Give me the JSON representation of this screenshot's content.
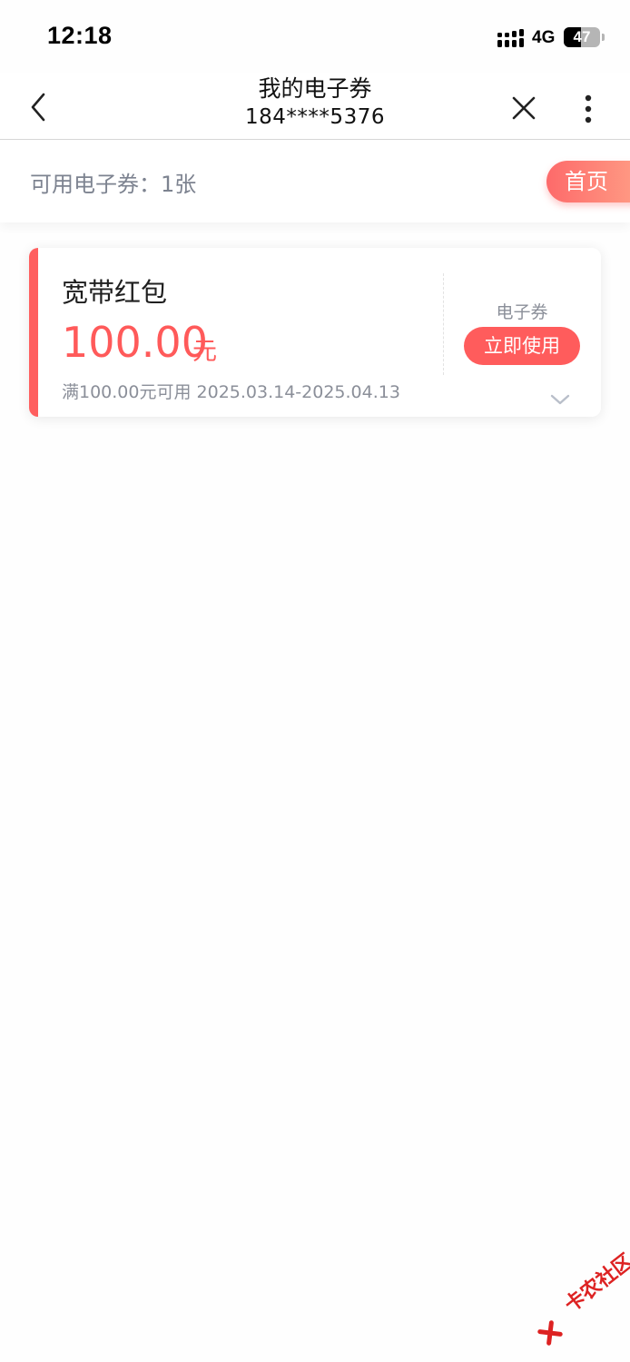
{
  "status_bar": {
    "time": "12:18",
    "network": "4G",
    "battery": "47",
    "battery_level": 0.47
  },
  "nav": {
    "title": "我的电子券",
    "subtitle": "184****5376",
    "back_icon": "chevron-left-icon",
    "close_icon": "close-icon",
    "more_icon": "more-vertical-icon"
  },
  "summary": {
    "label": "可用电子券：1张",
    "home_button": "首页"
  },
  "coupons": [
    {
      "name": "宽带红包",
      "amount": "100.00",
      "unit": "元",
      "condition": "满100.00元可用 2025.03.14-2025.04.13",
      "type": "电子券",
      "action": "立即使用",
      "expand_icon": "chevron-down-icon"
    }
  ],
  "watermark": {
    "text": "卡农社区"
  },
  "colors": {
    "accent": "#ff5c5c",
    "muted_text": "#8b8f99"
  }
}
